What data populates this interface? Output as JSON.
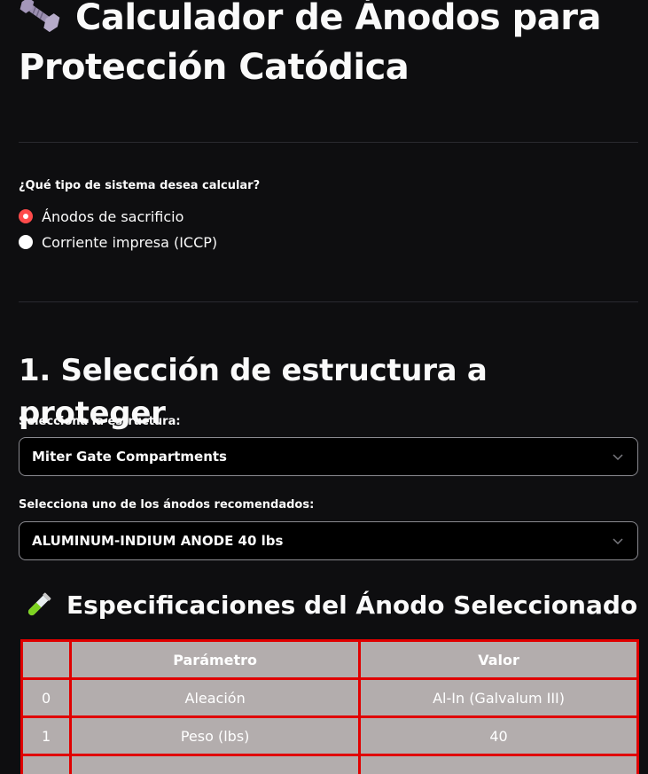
{
  "header": {
    "title": "Calculador de Ánodos para Protección Catódica",
    "icon": "nut-and-bolt-icon"
  },
  "system_type": {
    "label": "¿Qué tipo de sistema desea calcular?",
    "options": [
      {
        "label": "Ánodos de sacrificio",
        "selected": true
      },
      {
        "label": "Corriente impresa (ICCP)",
        "selected": false
      }
    ]
  },
  "section1": {
    "title": "1. Selección de estructura a proteger",
    "structure": {
      "label": "Selecciona la estructura:",
      "value": "Miter Gate Compartments"
    },
    "anode": {
      "label": "Selecciona uno de los ánodos recomendados:",
      "value": "ALUMINUM-INDIUM ANODE 40 lbs"
    }
  },
  "specs": {
    "title": "Especificaciones del Ánodo Seleccionado",
    "icon": "test-tube-icon",
    "columns": [
      "",
      "Parámetro",
      "Valor"
    ],
    "rows": [
      {
        "index": "0",
        "param": "Aleación",
        "value": "Al-In (Galvalum III)"
      },
      {
        "index": "1",
        "param": "Peso (lbs)",
        "value": "40"
      },
      {
        "index": "",
        "param": "",
        "value": ""
      }
    ]
  },
  "colors": {
    "background": "#0e0e10",
    "accent": "#ff4b4b",
    "table_border": "#e00000",
    "table_bg": "#b3adad"
  }
}
